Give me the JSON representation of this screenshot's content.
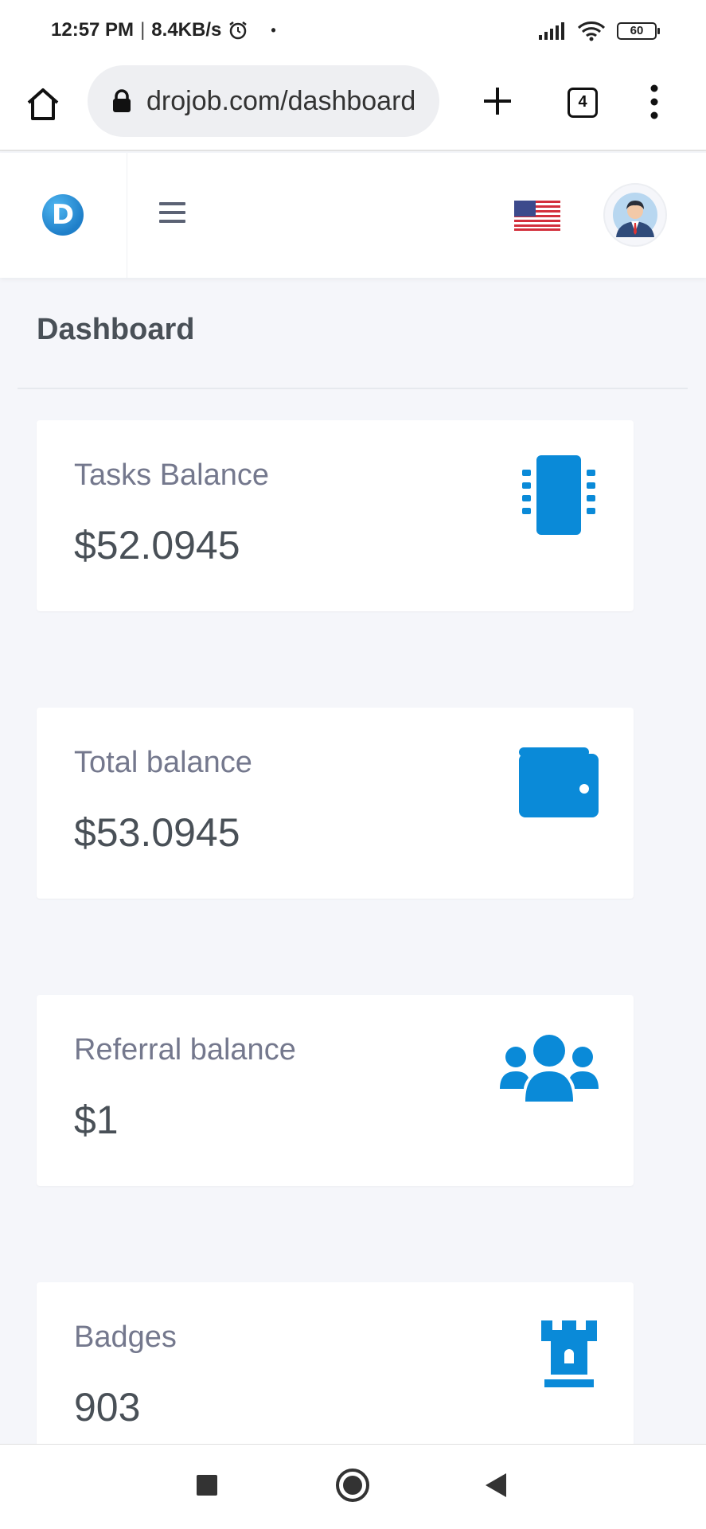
{
  "status_bar": {
    "time": "12:57 PM",
    "speed": "8.4KB/s",
    "battery": "60",
    "icons": [
      "alarm-icon",
      "signal-icon",
      "wifi-icon",
      "battery-icon"
    ]
  },
  "browser": {
    "url": "drojob.com/dashboard",
    "tab_count": "4",
    "icons": [
      "home-icon",
      "lock-icon",
      "plus-icon",
      "tabs-icon",
      "more-vert-icon"
    ]
  },
  "header": {
    "logo_letter": "D",
    "icons": [
      "menu-icon",
      "us-flag-icon",
      "user-avatar"
    ]
  },
  "page": {
    "title": "Dashboard"
  },
  "cards": [
    {
      "label": "Tasks Balance",
      "value": "$52.0945",
      "icon": "chip-icon"
    },
    {
      "label": "Total balance",
      "value": "$53.0945",
      "icon": "wallet-icon"
    },
    {
      "label": "Referral balance",
      "value": "$1",
      "icon": "users-icon"
    },
    {
      "label": "Badges",
      "value": "903",
      "icon": "tower-icon"
    }
  ],
  "colors": {
    "accent": "#0a8ad8",
    "background": "#f5f6fa",
    "label": "#74788d",
    "value": "#495057"
  }
}
